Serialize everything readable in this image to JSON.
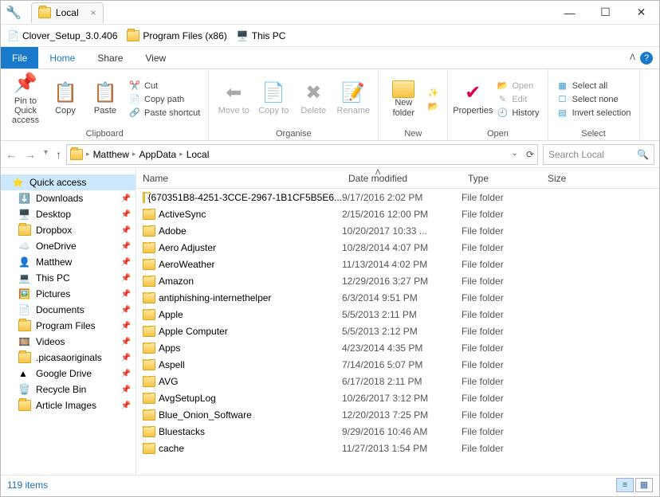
{
  "window": {
    "title": "Local"
  },
  "shortcuts": [
    {
      "label": "Clover_Setup_3.0.406",
      "icon": "file"
    },
    {
      "label": "Program Files (x86)",
      "icon": "folder"
    },
    {
      "label": "This PC",
      "icon": "pc"
    }
  ],
  "menu": {
    "file": "File",
    "tabs": [
      "Home",
      "Share",
      "View"
    ],
    "active": "Home"
  },
  "ribbon": {
    "clipboard": {
      "label": "Clipboard",
      "pin": "Pin to Quick access",
      "copy": "Copy",
      "paste": "Paste",
      "cut": "Cut",
      "copypath": "Copy path",
      "pasteshortcut": "Paste shortcut"
    },
    "organise": {
      "label": "Organise",
      "moveto": "Move to",
      "copyto": "Copy to",
      "delete": "Delete",
      "rename": "Rename"
    },
    "new": {
      "label": "New",
      "newfolder": "New folder"
    },
    "open": {
      "label": "Open",
      "properties": "Properties",
      "open": "Open",
      "edit": "Edit",
      "history": "History"
    },
    "select": {
      "label": "Select",
      "selectall": "Select all",
      "selectnone": "Select none",
      "invert": "Invert selection"
    }
  },
  "breadcrumb": [
    "Matthew",
    "AppData",
    "Local"
  ],
  "search": {
    "placeholder": "Search Local"
  },
  "columns": {
    "name": "Name",
    "date": "Date modified",
    "type": "Type",
    "size": "Size"
  },
  "sidebar": [
    {
      "label": "Quick access",
      "icon": "star",
      "sel": true,
      "indent": 0
    },
    {
      "label": "Downloads",
      "icon": "down",
      "pin": true,
      "indent": 1
    },
    {
      "label": "Desktop",
      "icon": "desk",
      "pin": true,
      "indent": 1
    },
    {
      "label": "Dropbox",
      "icon": "folder",
      "pin": true,
      "indent": 1
    },
    {
      "label": "OneDrive",
      "icon": "cloud",
      "pin": true,
      "indent": 1
    },
    {
      "label": "Matthew",
      "icon": "user",
      "pin": true,
      "indent": 1
    },
    {
      "label": "This PC",
      "icon": "pc",
      "pin": true,
      "indent": 1
    },
    {
      "label": "Pictures",
      "icon": "pic",
      "pin": true,
      "indent": 1
    },
    {
      "label": "Documents",
      "icon": "doc",
      "pin": true,
      "indent": 1
    },
    {
      "label": "Program Files",
      "icon": "folder",
      "pin": true,
      "indent": 1
    },
    {
      "label": "Videos",
      "icon": "vid",
      "pin": true,
      "indent": 1
    },
    {
      "label": ".picasaoriginals",
      "icon": "folder",
      "pin": true,
      "indent": 1
    },
    {
      "label": "Google Drive",
      "icon": "gd",
      "pin": true,
      "indent": 1
    },
    {
      "label": "Recycle Bin",
      "icon": "bin",
      "pin": true,
      "indent": 1
    },
    {
      "label": "Article Images",
      "icon": "folder",
      "pin": true,
      "indent": 1
    }
  ],
  "files": [
    {
      "name": "{670351B8-4251-3CCE-2967-1B1CF5B5E6...",
      "date": "9/17/2016 2:02 PM",
      "type": "File folder"
    },
    {
      "name": "ActiveSync",
      "date": "2/15/2016 12:00 PM",
      "type": "File folder"
    },
    {
      "name": "Adobe",
      "date": "10/20/2017 10:33 ...",
      "type": "File folder"
    },
    {
      "name": "Aero Adjuster",
      "date": "10/28/2014 4:07 PM",
      "type": "File folder"
    },
    {
      "name": "AeroWeather",
      "date": "11/13/2014 4:02 PM",
      "type": "File folder"
    },
    {
      "name": "Amazon",
      "date": "12/29/2016 3:27 PM",
      "type": "File folder"
    },
    {
      "name": "antiphishing-internethelper",
      "date": "6/3/2014 9:51 PM",
      "type": "File folder"
    },
    {
      "name": "Apple",
      "date": "5/5/2013 2:11 PM",
      "type": "File folder"
    },
    {
      "name": "Apple Computer",
      "date": "5/5/2013 2:12 PM",
      "type": "File folder"
    },
    {
      "name": "Apps",
      "date": "4/23/2014 4:35 PM",
      "type": "File folder"
    },
    {
      "name": "Aspell",
      "date": "7/14/2016 5:07 PM",
      "type": "File folder"
    },
    {
      "name": "AVG",
      "date": "6/17/2018 2:11 PM",
      "type": "File folder"
    },
    {
      "name": "AvgSetupLog",
      "date": "10/26/2017 3:12 PM",
      "type": "File folder"
    },
    {
      "name": "Blue_Onion_Software",
      "date": "12/20/2013 7:25 PM",
      "type": "File folder"
    },
    {
      "name": "Bluestacks",
      "date": "9/29/2016 10:46 AM",
      "type": "File folder"
    },
    {
      "name": "cache",
      "date": "11/27/2013 1:54 PM",
      "type": "File folder"
    }
  ],
  "status": {
    "count": "119 items"
  }
}
